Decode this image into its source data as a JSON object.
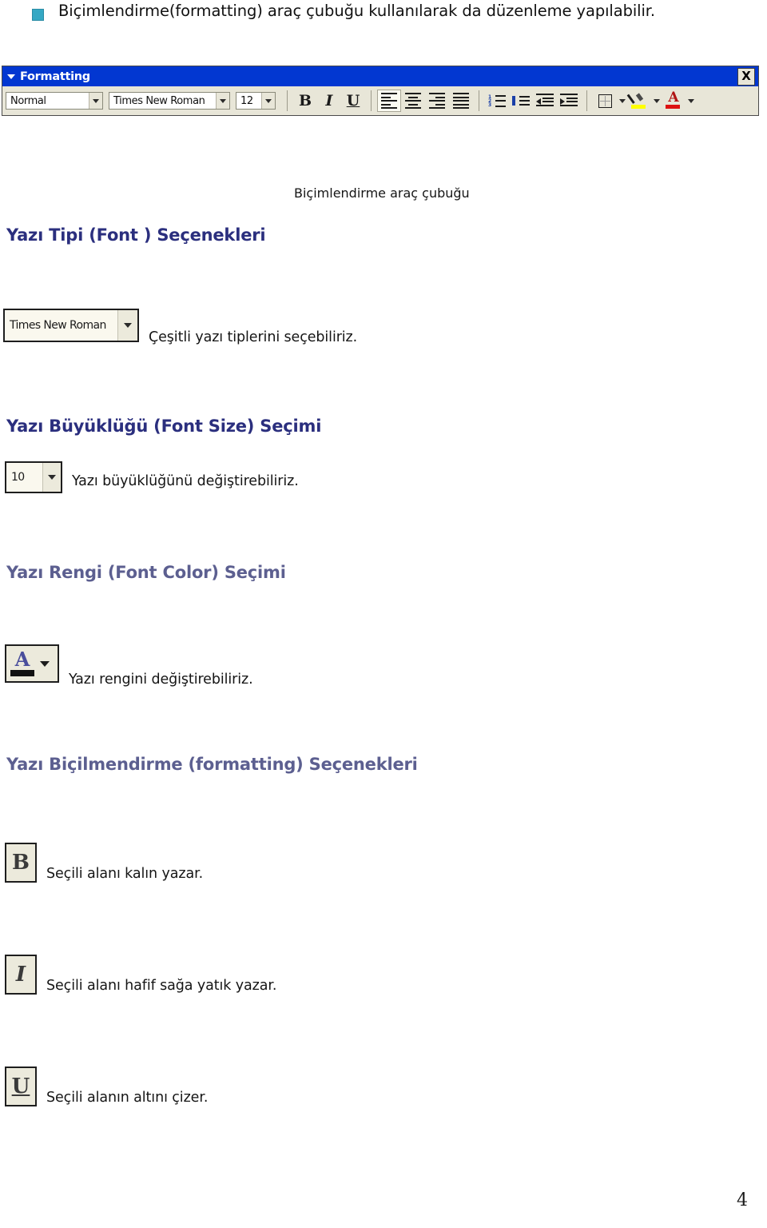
{
  "document": {
    "intro_bullet": "Biçimlendirme(formatting) araç çubuğu kullanılarak da düzenleme yapılabilir.",
    "toolbar_caption": "Biçimlendirme araç çubuğu",
    "page_number": "4"
  },
  "toolbar": {
    "title": "Formatting",
    "close_label": "X",
    "style_value": "Normal",
    "font_value": "Times New Roman",
    "size_value": "12",
    "buttons": {
      "bold": "B",
      "italic": "I",
      "underline": "U",
      "align_left": "align-left",
      "align_center": "align-center",
      "align_right": "align-right",
      "align_justify": "align-justify",
      "numbered_list": "numbered-list",
      "bulleted_list": "bulleted-list",
      "decrease_indent": "decrease-indent",
      "increase_indent": "increase-indent",
      "borders": "borders",
      "highlight": "highlight",
      "font_color": "font-color",
      "font_color_letter": "A"
    }
  },
  "sections": [
    {
      "heading": "Yazı Tipi (Font ) Seçenekleri",
      "heading_color": "#2b2f7e",
      "widget_value": "Times New Roman",
      "description": "Çeşitli yazı tiplerini seçebiliriz."
    },
    {
      "heading": "Yazı Büyüklüğü (Font Size)  Seçimi",
      "heading_color": "#2b2f7e",
      "widget_value": "10",
      "description": "Yazı büyüklüğünü değiştirebiliriz."
    },
    {
      "heading": "Yazı Rengi (Font Color) Seçimi",
      "heading_color": "#5c5f90",
      "widget_value": "A",
      "description": "Yazı rengini değiştirebiliriz."
    },
    {
      "heading": "Yazı Biçilmendirme (formatting) Seçenekleri",
      "heading_color": "#5c5f90",
      "items": [
        {
          "glyph": "B",
          "description": "Seçili alanı kalın yazar."
        },
        {
          "glyph": "I",
          "description": "Seçili alanı hafif sağa yatık yazar."
        },
        {
          "glyph": "U",
          "description": "Seçili alanın altını çizer."
        }
      ]
    }
  ],
  "colors": {
    "titlebar_blue": "#0237d1",
    "toolbar_face": "#e8e6d8",
    "bullet_teal": "#35a8c4",
    "heading_navy": "#2b2f7e",
    "heading_slate": "#5c5f90"
  }
}
